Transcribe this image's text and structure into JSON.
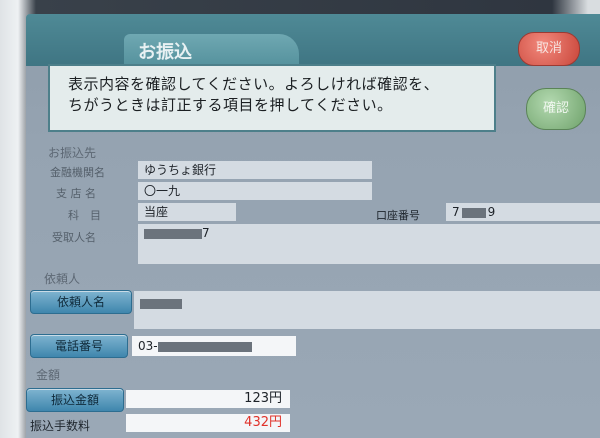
{
  "header": {
    "title": "お振込",
    "cancel_label": "取消"
  },
  "message": {
    "line1": "表示内容を確認してください。よろしければ確認を、",
    "line2": "ちがうときは訂正する項目を押してください。"
  },
  "confirm_label": "確認",
  "payee": {
    "section_label": "お振込先",
    "bank_label": "金融機関名",
    "bank_value": "ゆうちょ銀行",
    "branch_label": "支 店 名",
    "branch_value": "〇一九",
    "type_label": "科　目",
    "type_value": "当座",
    "account_label": "口座番号",
    "account_prefix": "7",
    "account_suffix": "9",
    "recipient_label": "受取人名",
    "recipient_suffix": "7"
  },
  "sender": {
    "section_label": "依頼人",
    "name_button": "依頼人名",
    "phone_button": "電話番号",
    "phone_prefix": "03-"
  },
  "amounts": {
    "section_label": "金額",
    "amount_button": "振込金額",
    "amount_value": "123円",
    "fee_label": "振込手数料",
    "fee_value": "432円"
  },
  "colors": {
    "fee": "#e0322a",
    "accent": "#3f86ad"
  }
}
